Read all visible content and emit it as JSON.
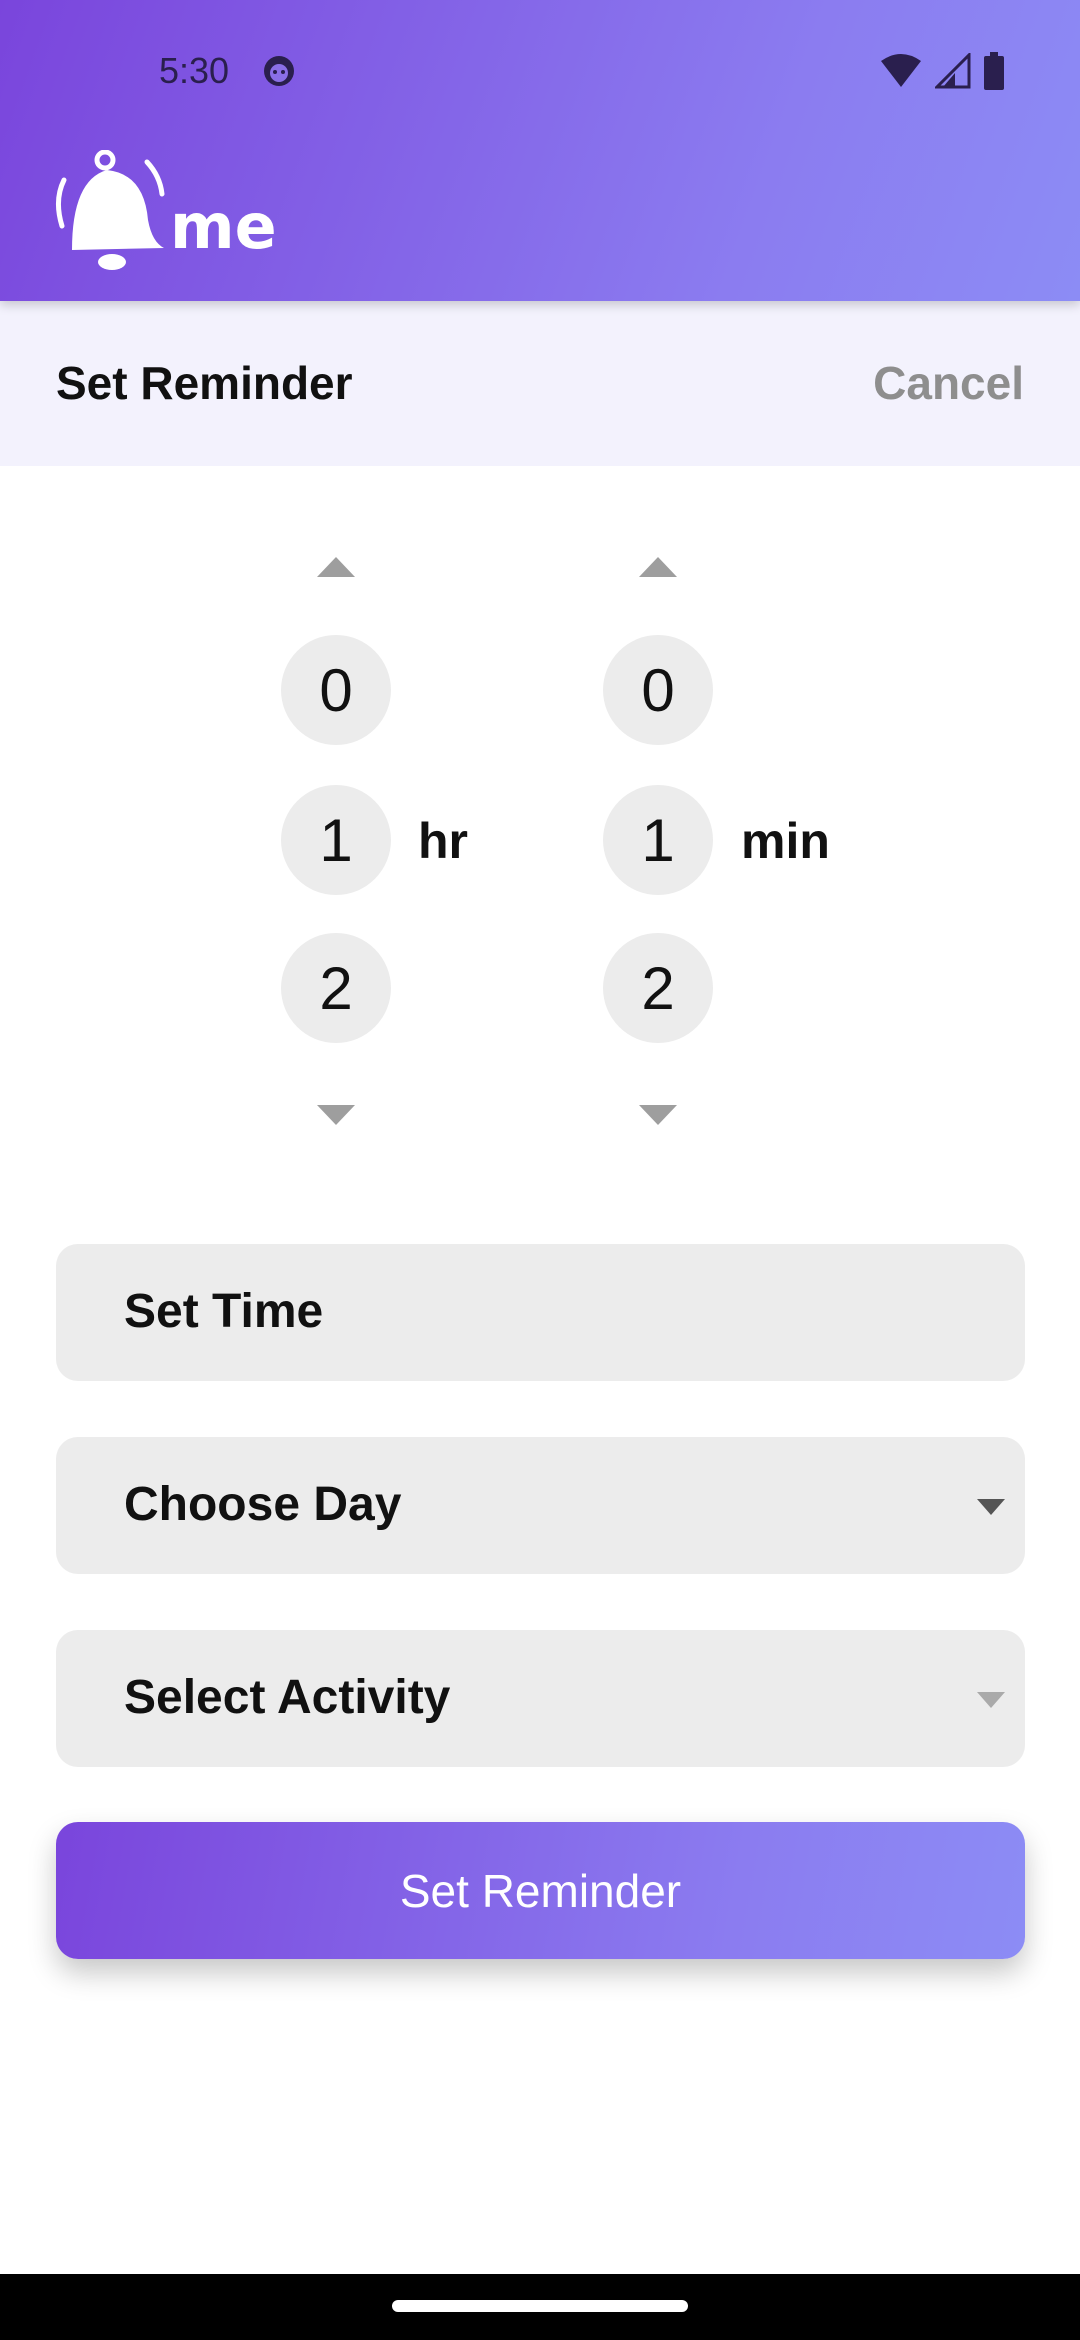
{
  "status_bar": {
    "time": "5:30",
    "icons": [
      "face-icon",
      "wifi-icon",
      "signal-icon",
      "battery-icon"
    ]
  },
  "header": {
    "logo_text": "me",
    "logo_icon": "bell-icon"
  },
  "title_bar": {
    "title": "Set Reminder",
    "cancel_label": "Cancel"
  },
  "pickers": {
    "hours": {
      "values": [
        "0",
        "1",
        "2"
      ],
      "unit": "hr"
    },
    "minutes": {
      "values": [
        "0",
        "1",
        "2"
      ],
      "unit": "min"
    }
  },
  "form": {
    "set_time_label": "Set Time",
    "choose_day_label": "Choose Day",
    "select_activity_label": "Select Activity",
    "submit_label": "Set Reminder"
  },
  "colors": {
    "brand_gradient_start": "#7a45dc",
    "brand_gradient_end": "#8c8cf5",
    "field_bg": "#ececec",
    "title_bar_bg": "#f3f2fd"
  }
}
